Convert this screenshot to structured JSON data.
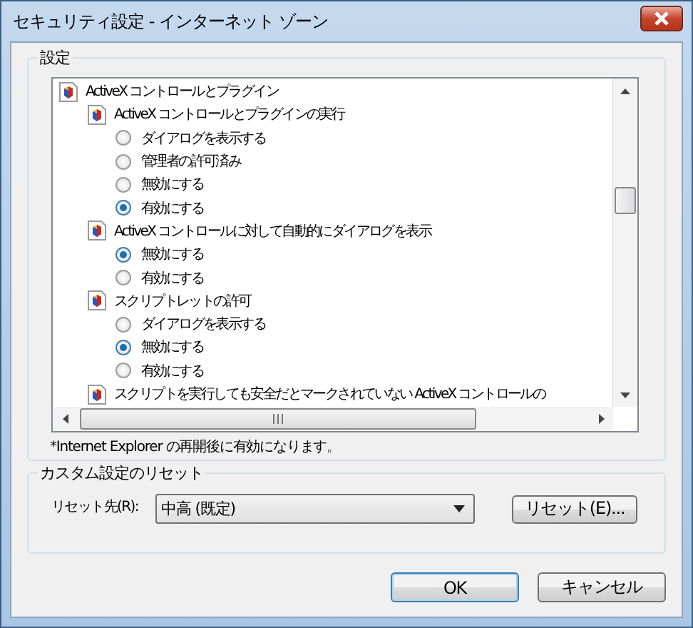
{
  "window": {
    "title": "セキュリティ設定 - インターネット ゾーン"
  },
  "settings": {
    "legend": "設定",
    "tree": [
      {
        "label": "ActiveX コントロールとプラグイン",
        "children": [
          {
            "label": "ActiveX コントロールとプラグインの実行",
            "options": [
              {
                "label": "ダイアログを表示する",
                "selected": false
              },
              {
                "label": "管理者の許可済み",
                "selected": false
              },
              {
                "label": "無効にする",
                "selected": false
              },
              {
                "label": "有効にする",
                "selected": true
              }
            ]
          },
          {
            "label": "ActiveX コントロールに対して自動的にダイアログを表示",
            "options": [
              {
                "label": "無効にする",
                "selected": true
              },
              {
                "label": "有効にする",
                "selected": false
              }
            ]
          },
          {
            "label": "スクリプトレットの許可",
            "options": [
              {
                "label": "ダイアログを表示する",
                "selected": false
              },
              {
                "label": "無効にする",
                "selected": true
              },
              {
                "label": "有効にする",
                "selected": false
              }
            ]
          },
          {
            "label": "スクリプトを実行しても安全だとマークされていない ActiveX コントロールの"
          }
        ]
      }
    ],
    "note": "*Internet Explorer の再開後に有効になります。"
  },
  "reset": {
    "legend": "カスタム設定のリセット",
    "label": "リセット先(R):",
    "value": "中高 (既定)",
    "button": "リセット(E)..."
  },
  "buttons": [
    {
      "label": "OK",
      "kind": "default"
    },
    {
      "label": "キャンセル",
      "kind": "normal"
    }
  ]
}
